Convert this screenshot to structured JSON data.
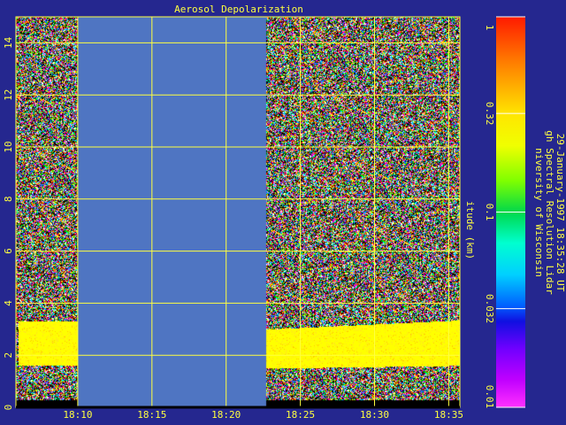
{
  "chart_data": {
    "type": "heatmap",
    "title": "Aerosol Depolarization",
    "xlabel": "",
    "ylabel": "itude (km)",
    "x_range": [
      "18:05:50",
      "18:35:45"
    ],
    "y_range": [
      0,
      15
    ],
    "x_ticks": [
      "18:10",
      "18:15",
      "18:20",
      "18:25",
      "18:30",
      "18:35"
    ],
    "x_tick_minutes": [
      10,
      15,
      20,
      25,
      30,
      35
    ],
    "y_ticks": [
      0,
      2,
      4,
      6,
      8,
      10,
      12,
      14
    ],
    "grid": true,
    "no_data_segments": [
      {
        "start": "18:10:00",
        "end": "18:22:40"
      }
    ],
    "depolarization_layer": {
      "description_segments": [
        {
          "start": "18:06",
          "end": "18:10",
          "bottom_km": 1.6,
          "top_km": 3.3
        },
        {
          "start": "18:22:40",
          "end": "18:35:45",
          "bottom_km": 1.5,
          "top_km": 3.0
        }
      ]
    },
    "colorbar": {
      "scale": "log",
      "range": [
        0.01,
        1
      ],
      "tick_labels": [
        "1",
        "0.32",
        "0.1",
        "0.032",
        "0.01"
      ],
      "tick_values": [
        1,
        0.32,
        0.1,
        0.032,
        0.01
      ]
    },
    "colors": {
      "background": "#25278f",
      "nodata": "#4f75c2",
      "grid": "#ffff40",
      "text": "#ffff40"
    }
  },
  "annotation": {
    "line1": "niversity of Wisconsin",
    "line2": "gh Spectral Resolution Lidar",
    "line3": "29-January-1997 18:35:28 UT"
  }
}
